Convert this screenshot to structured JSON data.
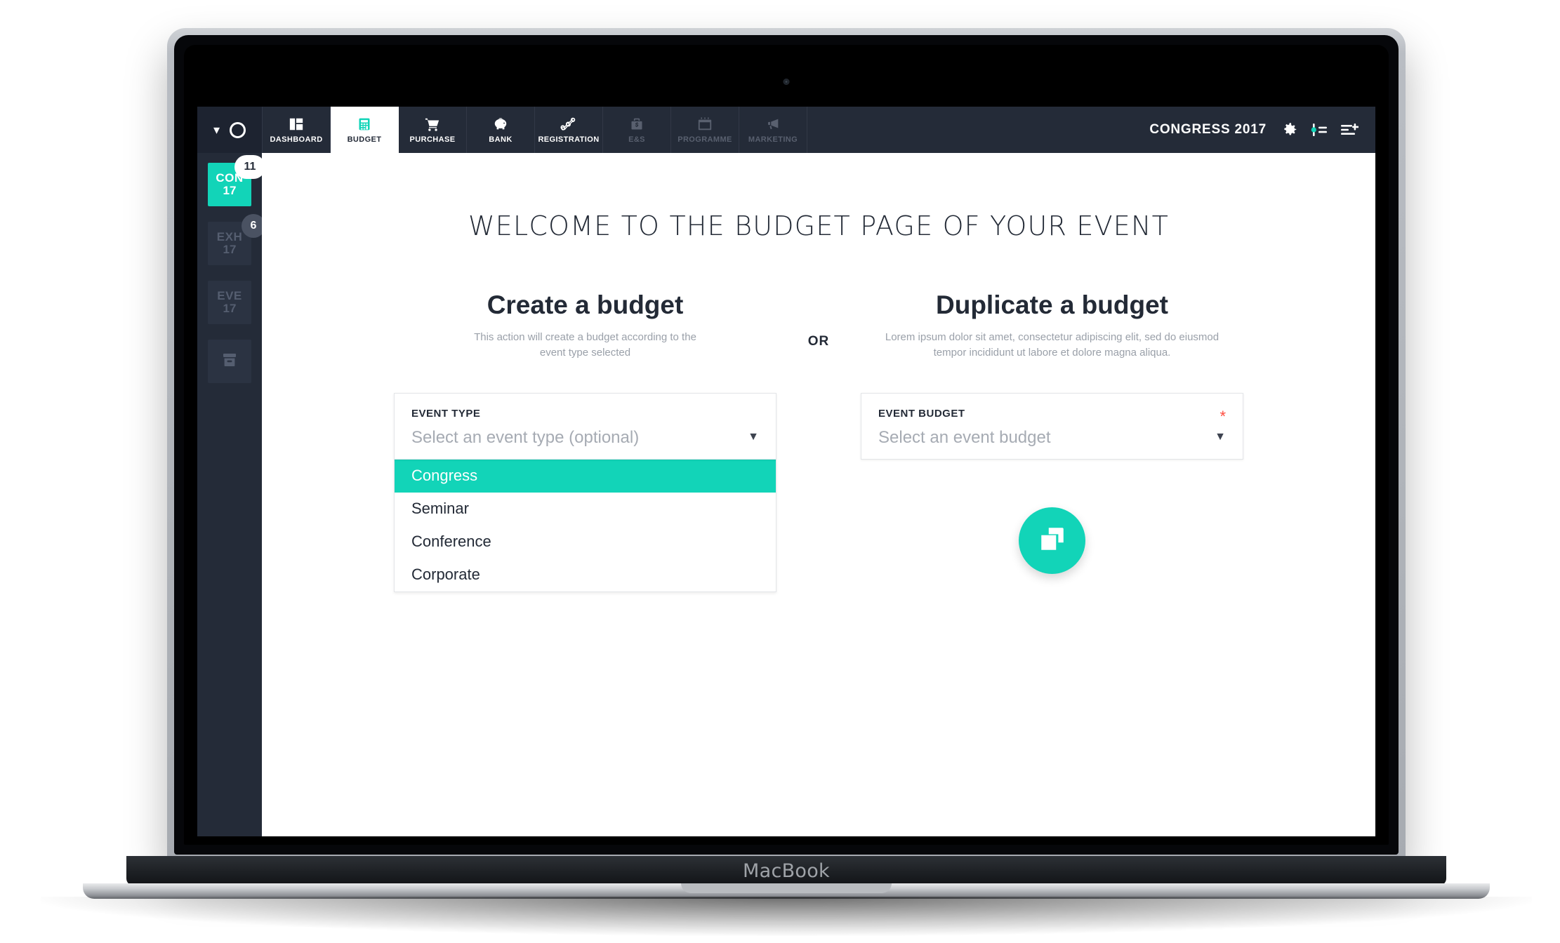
{
  "device": {
    "label": "MacBook"
  },
  "navbar": {
    "collapse_icon": "chevron-down-icon",
    "status_icon": "circle-icon",
    "tabs": [
      {
        "label": "DASHBOARD",
        "icon": "dashboard-icon",
        "state": "normal"
      },
      {
        "label": "BUDGET",
        "icon": "calculator-icon",
        "state": "active"
      },
      {
        "label": "PURCHASE",
        "icon": "shopping-cart-icon",
        "state": "normal"
      },
      {
        "label": "BANK",
        "icon": "piggy-bank-icon",
        "state": "normal"
      },
      {
        "label": "REGISTRATION",
        "icon": "line-chart-icon",
        "state": "normal"
      },
      {
        "label": "E&S",
        "icon": "briefcase-dollar-icon",
        "state": "disabled"
      },
      {
        "label": "PROGRAMME",
        "icon": "calendar-icon",
        "state": "disabled"
      },
      {
        "label": "MARKETING",
        "icon": "megaphone-icon",
        "state": "disabled"
      }
    ],
    "brand": "CONGRESS 2017",
    "actions": [
      {
        "name": "settings-gear-icon"
      },
      {
        "name": "user-settings-icon"
      },
      {
        "name": "add-list-icon"
      }
    ]
  },
  "sidebar": {
    "items": [
      {
        "line1": "CON",
        "line2": "17",
        "badge": "11",
        "state": "active",
        "badge_style": "light"
      },
      {
        "line1": "EXH",
        "line2": "17",
        "badge": "6",
        "state": "inactive",
        "badge_style": "grey"
      },
      {
        "line1": "EVE",
        "line2": "17",
        "badge": "",
        "state": "inactive",
        "badge_style": "none"
      },
      {
        "line1": "",
        "line2": "",
        "badge": "",
        "state": "archive",
        "badge_style": "none",
        "icon": "archive-box-icon"
      }
    ]
  },
  "main": {
    "page_title": "WELCOME TO THE BUDGET PAGE OF YOUR EVENT",
    "divider_label": "OR",
    "create": {
      "heading": "Create a budget",
      "subtitle": "This action will create a budget according to the event type selected",
      "field_label": "EVENT TYPE",
      "field_value": "Select an event type (optional)",
      "caret_icon": "caret-down-icon",
      "options": [
        {
          "label": "Congress",
          "selected": true
        },
        {
          "label": "Seminar",
          "selected": false
        },
        {
          "label": "Conference",
          "selected": false
        },
        {
          "label": "Corporate",
          "selected": false
        }
      ]
    },
    "duplicate": {
      "heading": "Duplicate a budget",
      "subtitle": "Lorem ipsum dolor sit amet, consectetur adipiscing elit, sed do eiusmod tempor incididunt ut labore et dolore magna aliqua.",
      "field_label": "EVENT BUDGET",
      "field_value": "Select an event budget",
      "required_marker": "*",
      "caret_icon": "caret-down-icon",
      "action_icon": "duplicate-icon"
    }
  },
  "colors": {
    "accent_teal": "#12d4b8",
    "nav_dark": "#242b38",
    "nav_left_dark": "#1d2330",
    "text_dark": "#232a36",
    "muted": "#9aa0a9",
    "required_red": "#ff4b3e"
  }
}
